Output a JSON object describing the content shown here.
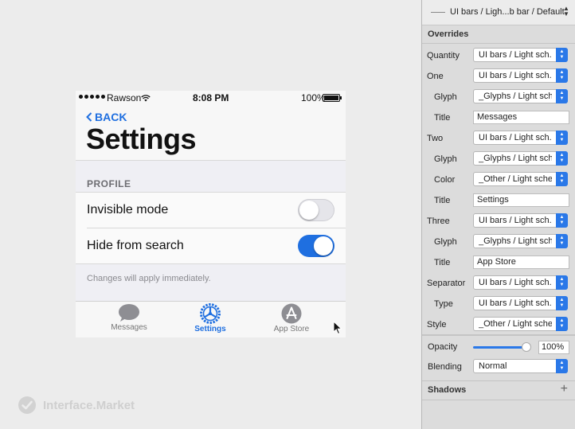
{
  "phone": {
    "status": {
      "carrier": "Rawson",
      "time": "8:08 PM",
      "battery": "100%"
    },
    "back_label": "BACK",
    "title": "Settings",
    "section_header": "PROFILE",
    "rows": [
      {
        "label": "Invisible mode",
        "on": false
      },
      {
        "label": "Hide from search",
        "on": true
      }
    ],
    "footer_note": "Changes will apply immediately.",
    "tabs": [
      {
        "label": "Messages",
        "icon": "chat-bubble-icon",
        "active": false
      },
      {
        "label": "Settings",
        "icon": "gear-icon",
        "active": true
      },
      {
        "label": "App Store",
        "icon": "app-store-icon",
        "active": false
      }
    ],
    "accent": "#1f6fe0"
  },
  "watermark": "Interface.Market",
  "inspector": {
    "symbol": "UI bars / Ligh...b bar / Default",
    "overrides_header": "Overrides",
    "props": [
      {
        "label": "Quantity",
        "value": "UI bars / Light sch...",
        "kind": "select",
        "indent": false
      },
      {
        "label": "One",
        "value": "UI bars / Light sch...",
        "kind": "select",
        "indent": false
      },
      {
        "label": "Glyph",
        "value": "_Glyphs / Light sch...",
        "kind": "select",
        "indent": true
      },
      {
        "label": "Title",
        "value": "Messages",
        "kind": "text",
        "indent": true
      },
      {
        "label": "Two",
        "value": "UI bars / Light sch...",
        "kind": "select",
        "indent": false
      },
      {
        "label": "Glyph",
        "value": "_Glyphs / Light sch...",
        "kind": "select",
        "indent": true
      },
      {
        "label": "Color",
        "value": "_Other / Light sche...",
        "kind": "select",
        "indent": true
      },
      {
        "label": "Title",
        "value": "Settings",
        "kind": "text",
        "indent": true
      },
      {
        "label": "Three",
        "value": "UI bars / Light sch...",
        "kind": "select",
        "indent": false
      },
      {
        "label": "Glyph",
        "value": "_Glyphs / Light sch...",
        "kind": "select",
        "indent": true
      },
      {
        "label": "Title",
        "value": "App Store",
        "kind": "text",
        "indent": true
      },
      {
        "label": "Separator",
        "value": "UI bars / Light sch...",
        "kind": "select",
        "indent": false
      },
      {
        "label": "Type",
        "value": "UI bars / Light sch...",
        "kind": "select",
        "indent": true
      },
      {
        "label": "Style",
        "value": "_Other / Light sche...",
        "kind": "select",
        "indent": false
      }
    ],
    "opacity_label": "Opacity",
    "opacity_value": "100%",
    "opacity_fraction": 1.0,
    "blending_label": "Blending",
    "blending_value": "Normal",
    "shadows_header": "Shadows"
  }
}
